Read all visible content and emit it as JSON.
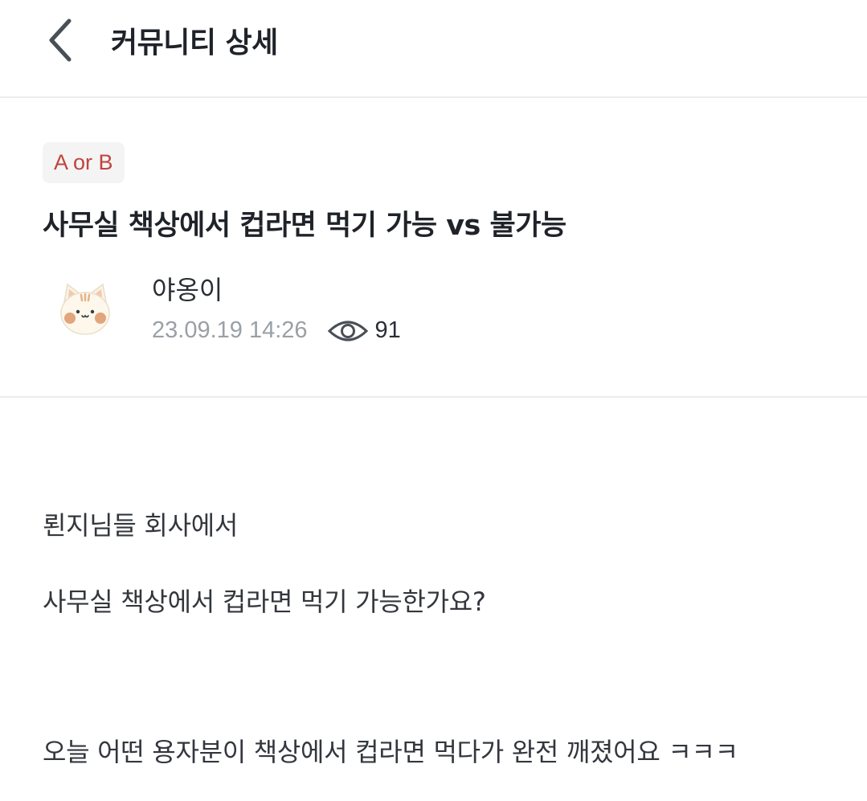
{
  "header": {
    "back_icon": "chevron-left-icon",
    "title": "커뮤니티 상세"
  },
  "post": {
    "tag": "A or B",
    "title": "사무실 책상에서 컵라면 먹기 가능 vs 불가능",
    "author": {
      "name": "야옹이",
      "avatar_icon": "cat-avatar-icon"
    },
    "date": "23.09.19 14:26",
    "views_icon": "eye-icon",
    "views": "91",
    "body": [
      "뢴지님들 회사에서",
      "사무실 책상에서 컵라면 먹기 가능한가요?",
      "오늘 어떤 용자분이 책상에서 컵라면 먹다가 완전 깨졌어요 ㅋㅋㅋ"
    ]
  },
  "colors": {
    "tag_text": "#c0443f",
    "tag_bg": "#f4f4f4",
    "meta_gray": "#9aa0a6",
    "divider": "#ececec"
  }
}
